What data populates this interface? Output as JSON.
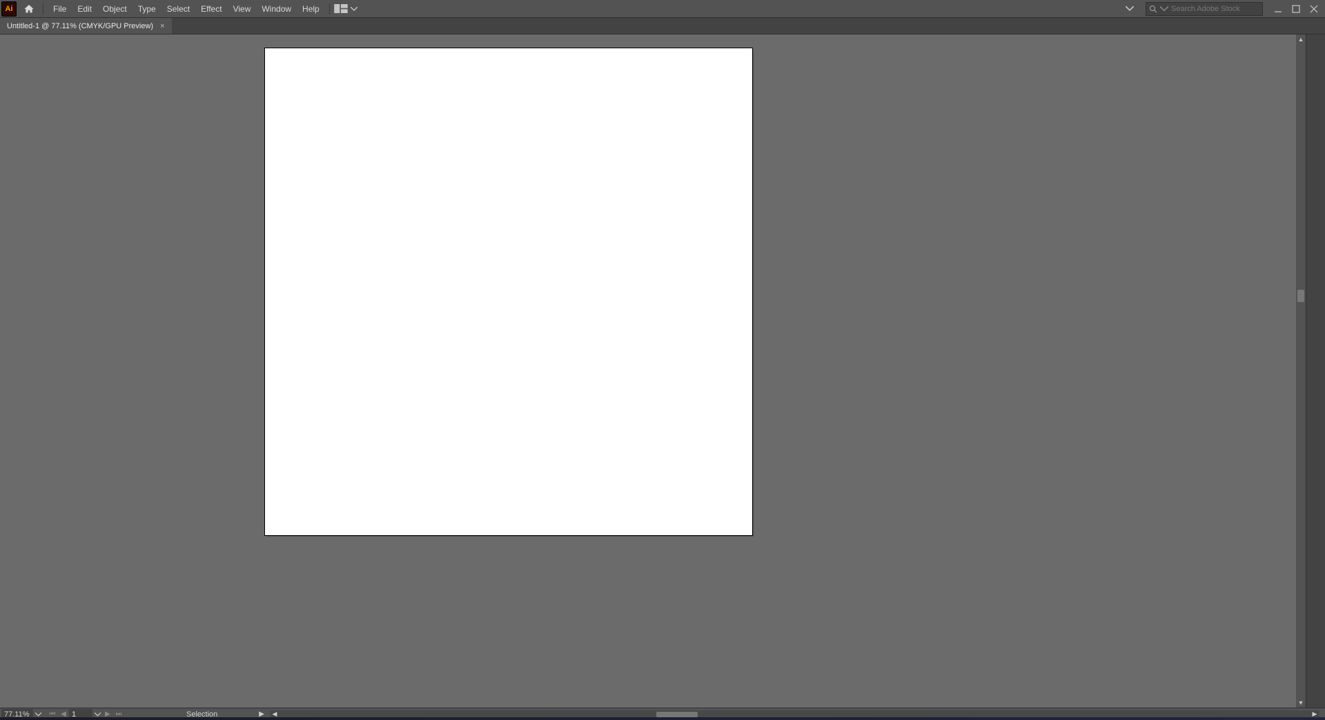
{
  "app": {
    "logo_text": "Ai"
  },
  "menu": {
    "items": [
      "File",
      "Edit",
      "Object",
      "Type",
      "Select",
      "Effect",
      "View",
      "Window",
      "Help"
    ]
  },
  "search": {
    "placeholder": "Search Adobe Stock"
  },
  "tab": {
    "label": "Untitled-1 @ 77.11% (CMYK/GPU Preview)"
  },
  "status": {
    "zoom": "77.11%",
    "artboard_number": "1",
    "tool": "Selection"
  }
}
